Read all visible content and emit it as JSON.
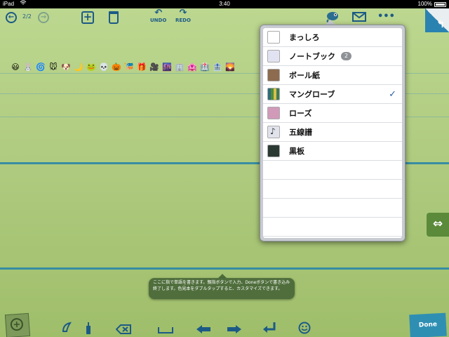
{
  "status": {
    "device": "iPad",
    "time": "3:40",
    "battery": "100%"
  },
  "toolbar": {
    "back_label": "←",
    "page_count": "2/2",
    "forward_label": "→",
    "add_label": "+",
    "undo_arrow": "↶",
    "undo_label": "UNDO",
    "redo_arrow": "↷",
    "redo_label": "REDO",
    "more_label": "•••"
  },
  "emoji": [
    "😃",
    "🐰",
    "🌀",
    "🐭",
    "🐶",
    "🌙",
    "🐸",
    "💀",
    "🎃",
    "🎏",
    "🎁",
    "🎥",
    "🌆",
    "🏢",
    "🏩",
    "🏥",
    "🏦",
    "🌄"
  ],
  "popover": {
    "items": [
      {
        "label": "まっしろ",
        "swatch": "#ffffff"
      },
      {
        "label": "ノートブック",
        "swatch": "#e2e3f2",
        "badge": "2"
      },
      {
        "label": "ボール紙",
        "swatch": "#8c6b4e"
      },
      {
        "label": "マングローブ",
        "swatch": "#3c6a39",
        "checked": true,
        "check": "✓"
      },
      {
        "label": "ローズ",
        "swatch": "#d19ab9"
      },
      {
        "label": "五線譜",
        "swatch": "#e0e2ec",
        "glyph": "♪"
      },
      {
        "label": "黒板",
        "swatch": "#2a3a33"
      }
    ]
  },
  "tooltip": "ここに指で単語を書きます。親指ボタンで入力、Doneボタンで書き込み終了します。色見本をダブルタップすると、カスタマイズできます。",
  "side_tab_label": "⇔",
  "done_label": "Done"
}
